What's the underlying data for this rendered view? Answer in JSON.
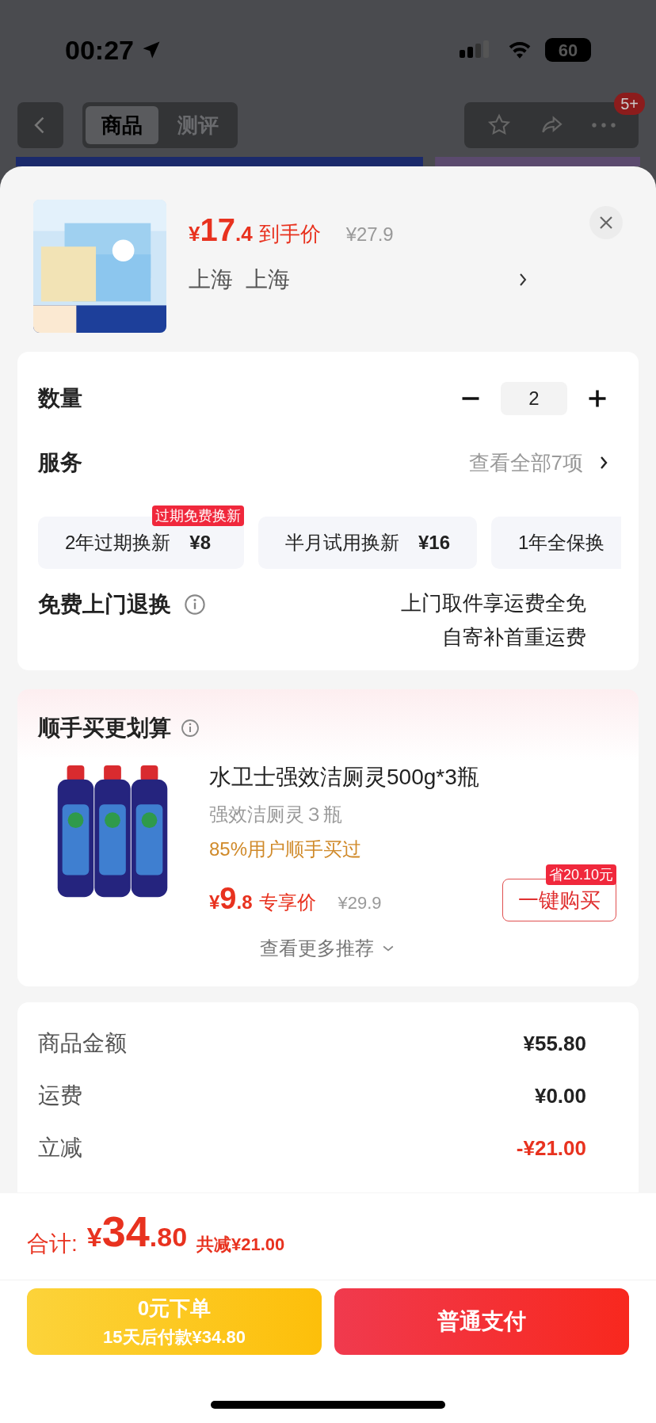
{
  "status_bar": {
    "time": "00:27",
    "battery": "60"
  },
  "nav": {
    "tabs": [
      {
        "label": "商品",
        "selected": true
      },
      {
        "label": "测评",
        "selected": false
      }
    ],
    "badge": "5+"
  },
  "product": {
    "price_symbol": "¥",
    "price_int": "17",
    "price_dec": ".4",
    "price_label": "到手价",
    "original_price": "¥27.9",
    "location": [
      "上海",
      "上海"
    ]
  },
  "quantity": {
    "label": "数量",
    "value": "2"
  },
  "services": {
    "label": "服务",
    "link": "查看全部7项",
    "options": [
      {
        "name": "2年过期换新",
        "price": "¥8",
        "tag": "过期免费换新"
      },
      {
        "name": "半月试用换新",
        "price": "¥16"
      },
      {
        "name": "1年全保换"
      }
    ]
  },
  "free_return": {
    "label": "免费上门退换",
    "lines": [
      "上门取件享运费全免",
      "自寄补首重运费"
    ]
  },
  "addon": {
    "title": "顺手买更划算",
    "item": {
      "name": "水卫士强效洁厕灵500g*3瓶",
      "spec": "强效洁厕灵３瓶",
      "note": "85%用户顺手买过",
      "price_symbol": "¥",
      "price_int": "9",
      "price_dec": ".8",
      "price_label": "专享价",
      "original_price": "¥29.9",
      "save_tag": "省20.10元",
      "button": "一键购买"
    },
    "more": "查看更多推荐"
  },
  "summary": [
    {
      "label": "商品金额",
      "value": "¥55.80",
      "kind": "normal"
    },
    {
      "label": "运费",
      "value": "¥0.00",
      "kind": "normal"
    },
    {
      "label": "立减",
      "value": "-¥21.00",
      "kind": "discount"
    }
  ],
  "footer": {
    "total": {
      "label": "合计:",
      "symbol": "¥",
      "int": "34",
      "dec": ".80",
      "saving": "共减¥21.00"
    },
    "buttons": [
      {
        "kind": "later",
        "title": "0元下单",
        "subtitle": "15天后付款¥34.80"
      },
      {
        "kind": "pay",
        "title": "普通支付"
      }
    ]
  }
}
